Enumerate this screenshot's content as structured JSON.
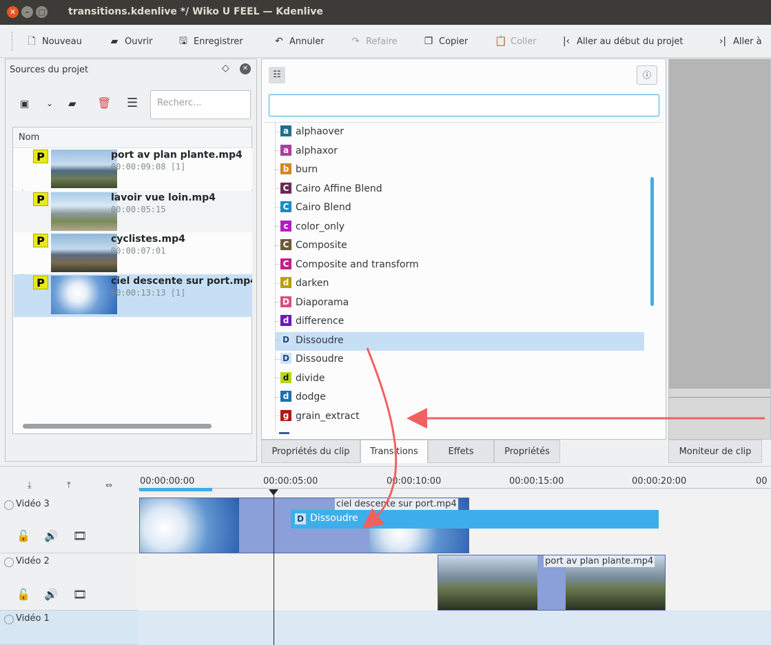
{
  "window": {
    "title": "transitions.kdenlive */ Wiko U FEEL — Kdenlive"
  },
  "toolbar": {
    "new": "Nouveau",
    "open": "Ouvrir",
    "save": "Enregistrer",
    "undo": "Annuler",
    "redo": "Refaire",
    "copy": "Copier",
    "paste": "Coller",
    "goto_start": "Aller au début du projet",
    "goto_end": "Aller à"
  },
  "project_bin": {
    "title": "Sources du projet",
    "search_placeholder": "Recherc...",
    "column_name": "Nom",
    "clips": [
      {
        "name": "port av plan plante.mp4",
        "duration": "00:00:09:08  [1]",
        "badge": "P"
      },
      {
        "name": "lavoir vue loin.mp4",
        "duration": "00:00:05:15",
        "badge": "P"
      },
      {
        "name": "cyclistes.mp4",
        "duration": "00:00:07:01",
        "badge": "P"
      },
      {
        "name": "ciel descente sur port.mp4",
        "duration": "00:00:13:13  [1]",
        "badge": "P"
      }
    ]
  },
  "transitions": {
    "items": [
      {
        "letter": "a",
        "label": "alphaover",
        "color": "#1f6f8b"
      },
      {
        "letter": "a",
        "label": "alphaxor",
        "color": "#b03ca0"
      },
      {
        "letter": "b",
        "label": "burn",
        "color": "#d4881c"
      },
      {
        "letter": "C",
        "label": "Cairo Affine Blend",
        "color": "#6b2a55"
      },
      {
        "letter": "C",
        "label": "Cairo Blend",
        "color": "#1a8cc4"
      },
      {
        "letter": "c",
        "label": "color_only",
        "color": "#b020c0"
      },
      {
        "letter": "C",
        "label": "Composite",
        "color": "#6a5a3a"
      },
      {
        "letter": "C",
        "label": "Composite and transform",
        "color": "#c0208a"
      },
      {
        "letter": "d",
        "label": "darken",
        "color": "#b8a000"
      },
      {
        "letter": "D",
        "label": "Diaporama",
        "color": "#d85080"
      },
      {
        "letter": "d",
        "label": "difference",
        "color": "#6a18b8"
      },
      {
        "letter": "D",
        "label": "Dissoudre",
        "color": "#cfe3f6"
      },
      {
        "letter": "D",
        "label": "Dissoudre",
        "color": "#cfe3f6"
      },
      {
        "letter": "d",
        "label": "divide",
        "color": "#b8d818"
      },
      {
        "letter": "d",
        "label": "dodge",
        "color": "#1a70b0"
      },
      {
        "letter": "g",
        "label": "grain_extract",
        "color": "#b01818"
      }
    ],
    "selected_index": 11
  },
  "bottom_tabs": {
    "clip_props": "Propriétés du clip",
    "transitions": "Transitions",
    "effects": "Effets",
    "properties": "Propriétés",
    "clip_monitor": "Moniteur de clip"
  },
  "timeline": {
    "ticks": [
      "00:00:00:00",
      "00:00:05:00",
      "00:00:10:00",
      "00:00:15:00",
      "00:00:20:00",
      "00"
    ],
    "tracks": [
      {
        "name": "Vidéo 3"
      },
      {
        "name": "Vidéo 2"
      },
      {
        "name": "Vidéo 1"
      }
    ],
    "clip_v3": "ciel descente sur port.mp4",
    "clip_v2": "port av plan plante.mp4",
    "transition_label": "Dissoudre",
    "transition_letter": "D"
  },
  "colors": {
    "accent": "#3daee9",
    "selection": "#c7dff5",
    "annotation_arrow": "#f06060"
  }
}
